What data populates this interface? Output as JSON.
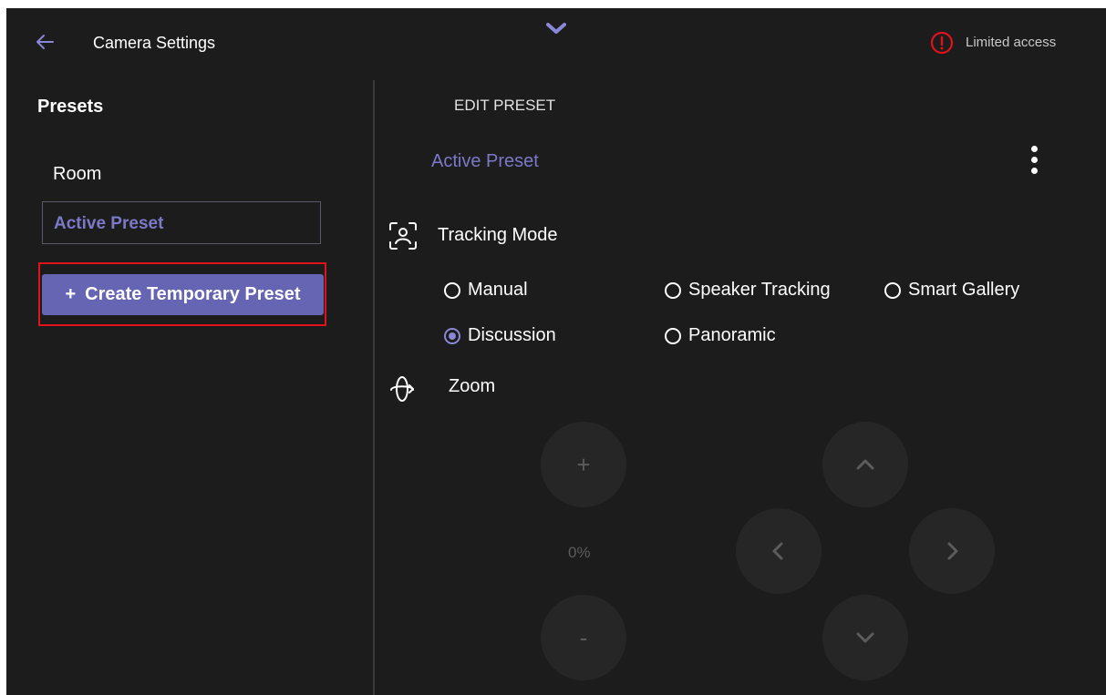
{
  "header": {
    "title": "Camera Settings",
    "back_icon": "arrow-left-icon",
    "collapse_icon": "chevron-down-icon",
    "access_icon": "alert-circle-icon",
    "access_text": "Limited access"
  },
  "sidebar": {
    "heading": "Presets",
    "items": [
      {
        "label": "Room",
        "selected": false
      },
      {
        "label": "Active Preset",
        "selected": true
      }
    ],
    "create_button": {
      "plus": "+",
      "label": "Create Temporary Preset"
    }
  },
  "main": {
    "section_title": "EDIT PRESET",
    "preset_name": "Active Preset",
    "menu_icon": "more-vertical-icon",
    "tracking": {
      "label": "Tracking Mode",
      "icon": "face-tracking-icon",
      "options": [
        {
          "label": "Manual",
          "checked": false
        },
        {
          "label": "Speaker Tracking",
          "checked": false
        },
        {
          "label": "Smart Gallery",
          "checked": false
        },
        {
          "label": "Discussion",
          "checked": true
        },
        {
          "label": "Panoramic",
          "checked": false
        }
      ]
    },
    "zoom": {
      "label": "Zoom",
      "icon": "pan-rotate-icon",
      "plus": "+",
      "minus": "-",
      "value": "0%"
    },
    "pan": {
      "up_icon": "chevron-up-icon",
      "left_icon": "chevron-left-icon",
      "right_icon": "chevron-right-icon",
      "down_icon": "chevron-down-icon"
    }
  },
  "colors": {
    "background": "#1c1c1c",
    "accent": "#6665b3",
    "accent_text": "#7c79c8",
    "highlight_border": "#e0121b",
    "warning": "#e0121b",
    "control_bg": "#262626"
  }
}
